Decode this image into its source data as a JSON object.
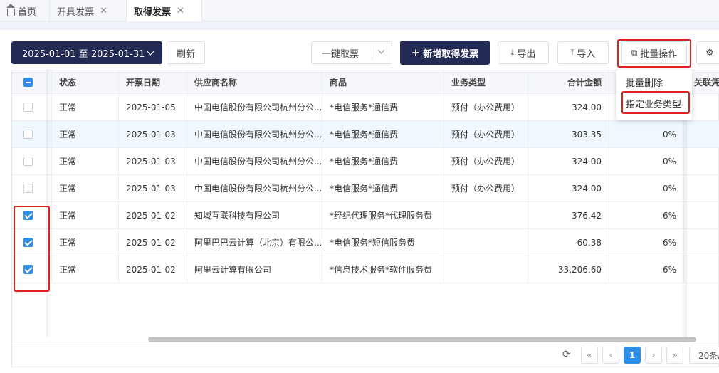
{
  "tabs": [
    {
      "label": "首页",
      "closable": false
    },
    {
      "label": "开具发票",
      "closable": true
    },
    {
      "label": "取得发票",
      "closable": true,
      "active": true
    }
  ],
  "toolbar": {
    "date_range": "2025-01-01 至 2025-01-31",
    "refresh": "刷新",
    "one_click_fetch": "一键取票",
    "add_invoice": "新增取得发票",
    "export": "导出",
    "import": "导入",
    "batch_ops": "批量操作"
  },
  "dropdown": {
    "items": [
      "批量删除",
      "指定业务类型"
    ]
  },
  "table": {
    "columns": [
      "状态",
      "开票日期",
      "供应商名称",
      "商品",
      "业务类型",
      "合计金额",
      "",
      "关联凭"
    ],
    "rows": [
      {
        "checked": false,
        "status": "正常",
        "date": "2025-01-05",
        "supplier": "中国电信股份有限公司杭州分公...",
        "goods": "*电信服务*通信费",
        "biz_type": "预付（办公费用）",
        "amount": "324.00",
        "rate": ""
      },
      {
        "checked": false,
        "status": "正常",
        "date": "2025-01-03",
        "supplier": "中国电信股份有限公司杭州分公...",
        "goods": "*电信服务*通信费",
        "biz_type": "预付（办公费用）",
        "amount": "303.35",
        "rate": "0%"
      },
      {
        "checked": false,
        "status": "正常",
        "date": "2025-01-03",
        "supplier": "中国电信股份有限公司杭州分公...",
        "goods": "*电信服务*通信费",
        "biz_type": "预付（办公费用）",
        "amount": "324.00",
        "rate": "0%"
      },
      {
        "checked": false,
        "status": "正常",
        "date": "2025-01-03",
        "supplier": "中国电信股份有限公司杭州分公...",
        "goods": "*电信服务*通信费",
        "biz_type": "预付（办公费用）",
        "amount": "324.00",
        "rate": "0%"
      },
      {
        "checked": true,
        "status": "正常",
        "date": "2025-01-02",
        "supplier": "知域互联科技有限公司",
        "goods": "*经纪代理服务*代理服务费",
        "biz_type": "",
        "amount": "376.42",
        "rate": "6%"
      },
      {
        "checked": true,
        "status": "正常",
        "date": "2025-01-02",
        "supplier": "阿里巴巴云计算（北京）有限公...",
        "goods": "*电信服务*短信服务费",
        "biz_type": "",
        "amount": "60.38",
        "rate": "6%"
      },
      {
        "checked": true,
        "status": "正常",
        "date": "2025-01-02",
        "supplier": "阿里云计算有限公司",
        "goods": "*信息技术服务*软件服务费",
        "biz_type": "",
        "amount": "33,206.60",
        "rate": "6%"
      }
    ]
  },
  "pagination": {
    "current_page": "1",
    "page_size": "20条/"
  },
  "colors": {
    "accent": "#2f8ee5",
    "primary_dark": "#232b55",
    "highlight_red": "#e02020",
    "row_highlight": "#eef8fd"
  },
  "icons": [
    "home-icon",
    "close-icon",
    "chevron-down-icon",
    "plus-icon",
    "download-icon",
    "upload-icon",
    "copy-icon",
    "gear-icon",
    "refresh-icon"
  ]
}
